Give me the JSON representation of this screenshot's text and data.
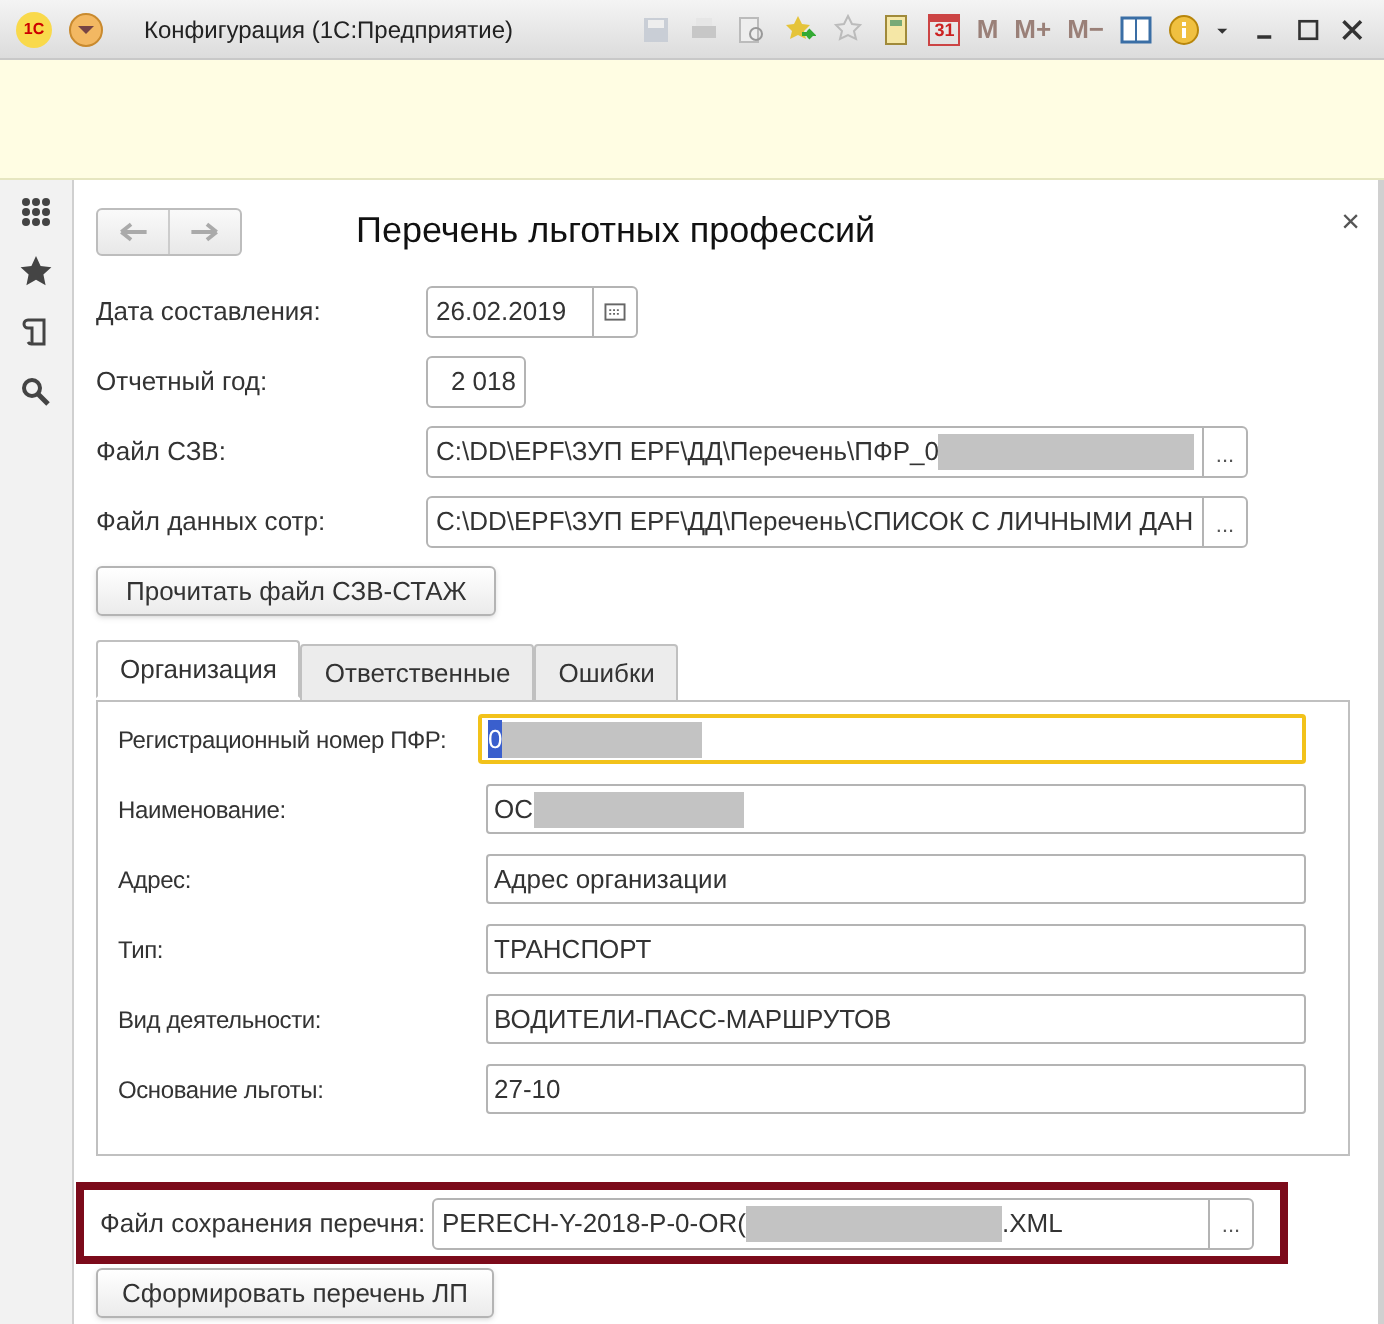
{
  "window": {
    "title": "Конфигурация  (1С:Предприятие)",
    "logo": "1С",
    "calendar_day": "31",
    "memory_buttons": [
      {
        "label": "M",
        "disabled": true
      },
      {
        "label": "M+",
        "disabled": true
      },
      {
        "label": "M−",
        "disabled": true
      }
    ]
  },
  "form": {
    "title": "Перечень льготных профессий",
    "close": "×",
    "fields": [
      {
        "kind": "date",
        "label": "Дата составления:",
        "value": "26.02.2019"
      },
      {
        "kind": "number",
        "label": "Отчетный год:",
        "value": "2 018"
      },
      {
        "kind": "file",
        "label": "Файл СЗВ:",
        "value": "C:\\DD\\EPF\\ЗУП EPF\\ДД\\Перечень\\ПФР_0",
        "redacted": true,
        "button": "..."
      },
      {
        "kind": "file",
        "label": "Файл данных сотр:",
        "value": "C:\\DD\\EPF\\ЗУП EPF\\ДД\\Перечень\\СПИСОК С ЛИЧНЫМИ ДАН",
        "redacted": false,
        "button": "..."
      }
    ],
    "read_button": "Прочитать файл СЗВ-СТАЖ",
    "tabs": [
      {
        "label": "Организация",
        "selected": true
      },
      {
        "label": "Ответственные",
        "selected": false
      },
      {
        "label": "Ошибки",
        "selected": false
      }
    ],
    "org_fields": [
      {
        "label": "Регистрационный номер ПФР:",
        "value": "0",
        "redacted": true,
        "focused": true
      },
      {
        "label": "Наименование:",
        "value": "ОС",
        "redacted": true,
        "focused": false
      },
      {
        "label": "Адрес:",
        "value": "Адрес организации",
        "redacted": false,
        "focused": false
      },
      {
        "label": "Тип:",
        "value": "ТРАНСПОРТ",
        "redacted": false,
        "focused": false
      },
      {
        "label": "Вид деятельности:",
        "value": "ВОДИТЕЛИ-ПАСС-МАРШРУТОВ",
        "redacted": false,
        "focused": false
      },
      {
        "label": "Основание льготы:",
        "value": "27-10",
        "redacted": false,
        "focused": false
      }
    ],
    "save_file": {
      "label": "Файл сохранения перечня:",
      "value": "PERECH-Y-2018-P-0-OR(",
      "redacted": true,
      "value_end": ".XML",
      "button": "...",
      "highlighted": true
    },
    "build_button": "Сформировать перечень ЛП"
  }
}
